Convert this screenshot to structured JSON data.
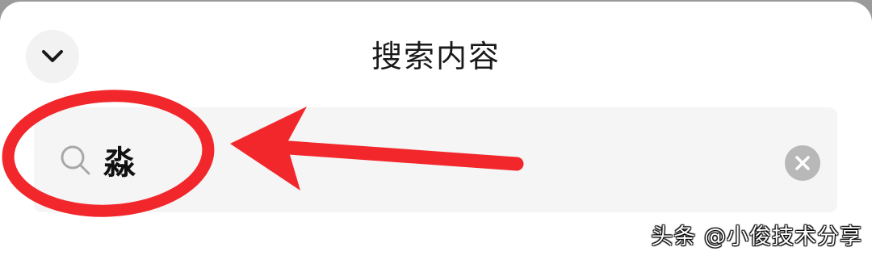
{
  "header": {
    "title": "搜索内容",
    "collapse_icon": "chevron-down-icon"
  },
  "search": {
    "value": "淼",
    "search_icon": "search-icon",
    "clear_icon": "clear-icon"
  },
  "annotation": {
    "color": "#f2272b",
    "shapes": [
      "ellipse",
      "arrow"
    ]
  },
  "watermark": {
    "text": "头条 @小俊技术分享"
  }
}
